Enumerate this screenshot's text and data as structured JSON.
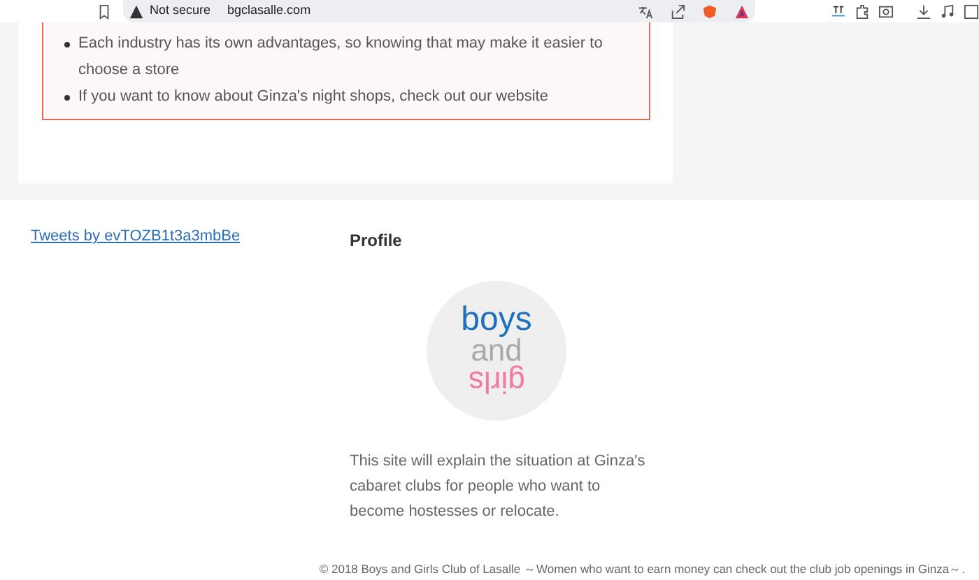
{
  "browser": {
    "security_label": "Not secure",
    "url": "bgclasalle.com"
  },
  "article": {
    "bullets": [
      "Each industry has its own advantages, so knowing that may make it easier to choose a store",
      "If you want to know about Ginza's night shops, check out our website"
    ]
  },
  "sidebar": {
    "tweets_link": "Tweets by evTOZB1t3a3mbBe"
  },
  "profile": {
    "heading": "Profile",
    "logo_words": [
      "boys",
      "and",
      "girls"
    ],
    "description": "This site will explain the situation at Ginza's cabaret clubs for people who want to become hostesses or relocate."
  },
  "footer": {
    "copyright": "© 2018 Boys and Girls Club of Lasalle ～Women who want to earn money can check out the club job openings in Ginza～."
  }
}
